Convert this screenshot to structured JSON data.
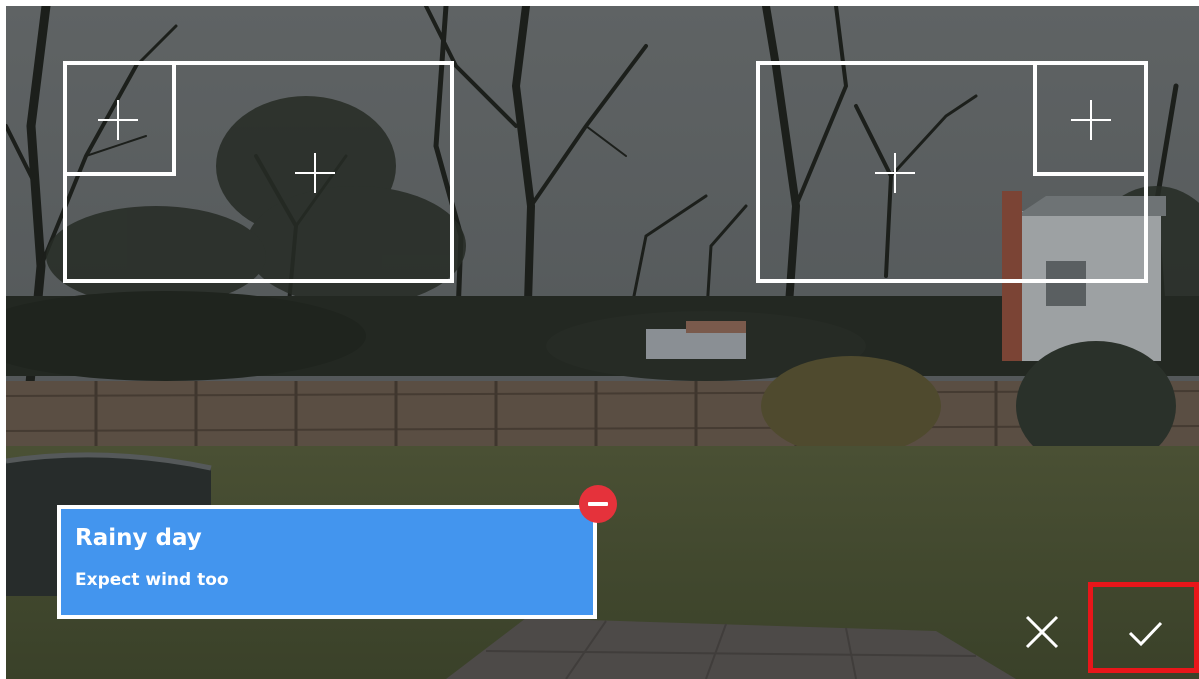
{
  "text_card": {
    "title": "Rainy day",
    "subtitle": "Expect wind too",
    "background_color": "#4395ee"
  },
  "icons": {
    "remove": "minus-circle-icon",
    "cancel": "close-icon",
    "confirm": "checkmark-icon",
    "add": "plus-icon"
  },
  "colors": {
    "remove_badge": "#e5323b",
    "confirm_highlight": "#e8161a",
    "overlay_lines": "#ffffff"
  }
}
